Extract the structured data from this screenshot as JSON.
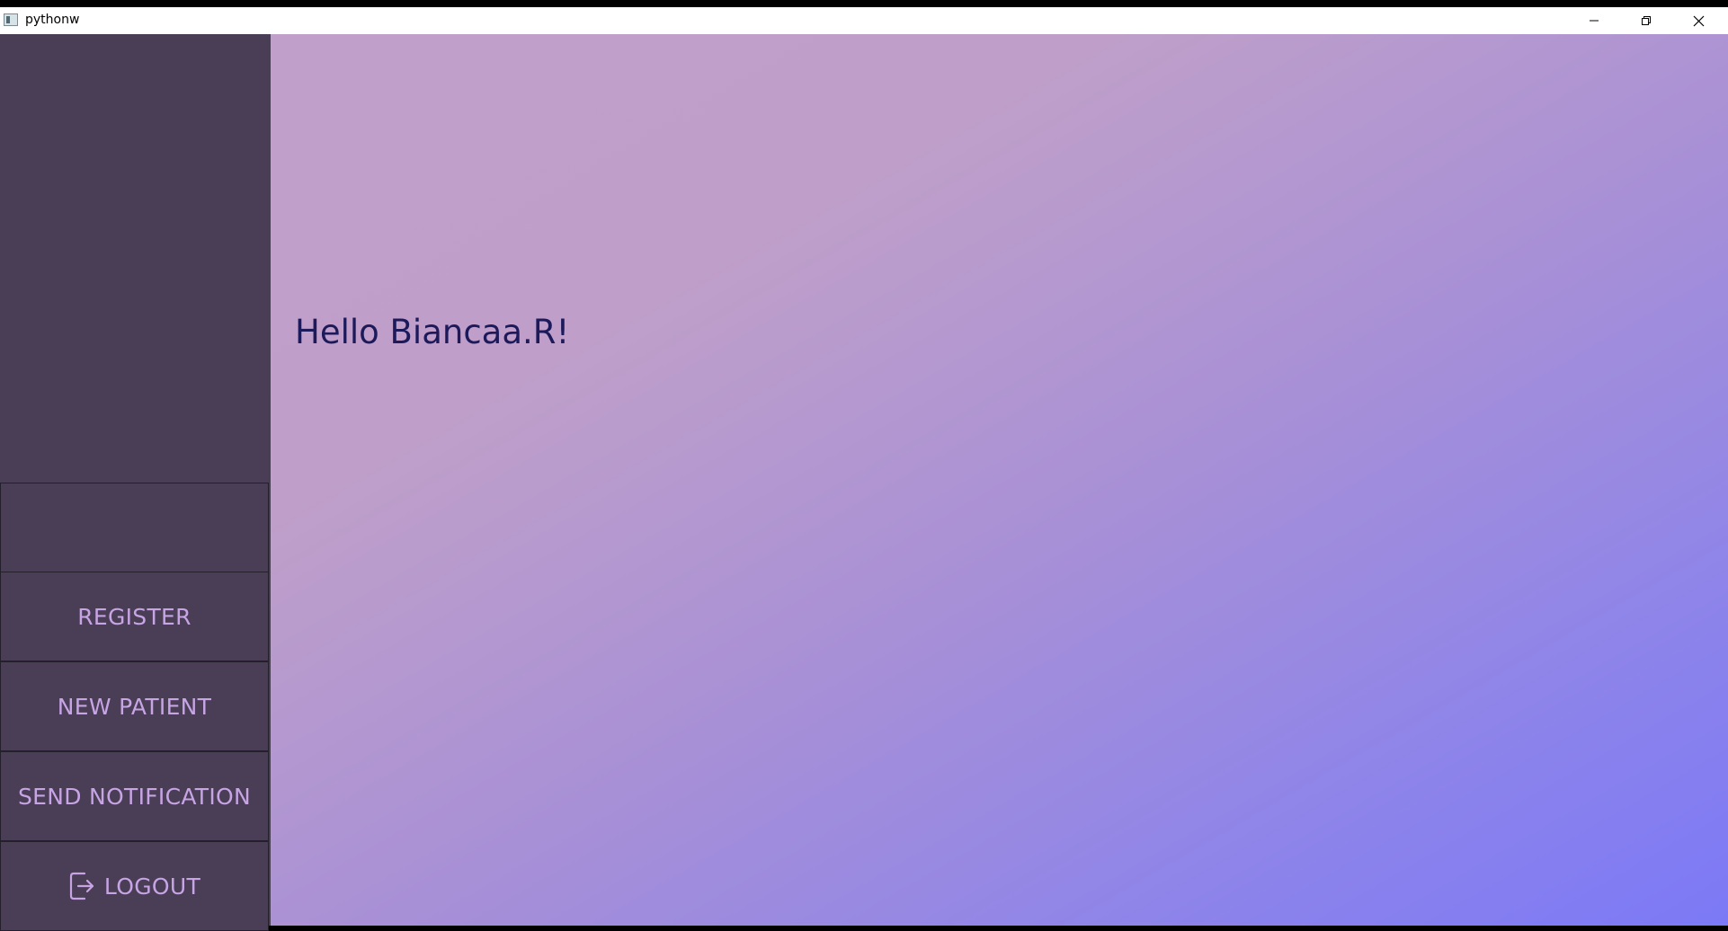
{
  "window": {
    "title": "pythonw",
    "controls": {
      "minimize_icon": "minimize-icon",
      "maximize_icon": "restore-icon",
      "close_icon": "close-icon"
    }
  },
  "sidebar": {
    "background_color": "#4a3d56",
    "text_color": "#c7a4e4",
    "items": [
      {
        "label": "REGISTER"
      },
      {
        "label": "NEW PATIENT"
      },
      {
        "label": "SEND NOTIFICATION"
      },
      {
        "label": "LOGOUT",
        "icon": "logout-icon"
      }
    ]
  },
  "main": {
    "greeting": "Hello Biancaa.R!",
    "greeting_color": "#1c1a5a",
    "gradient": [
      "#c09fca",
      "#7c79f6"
    ]
  }
}
